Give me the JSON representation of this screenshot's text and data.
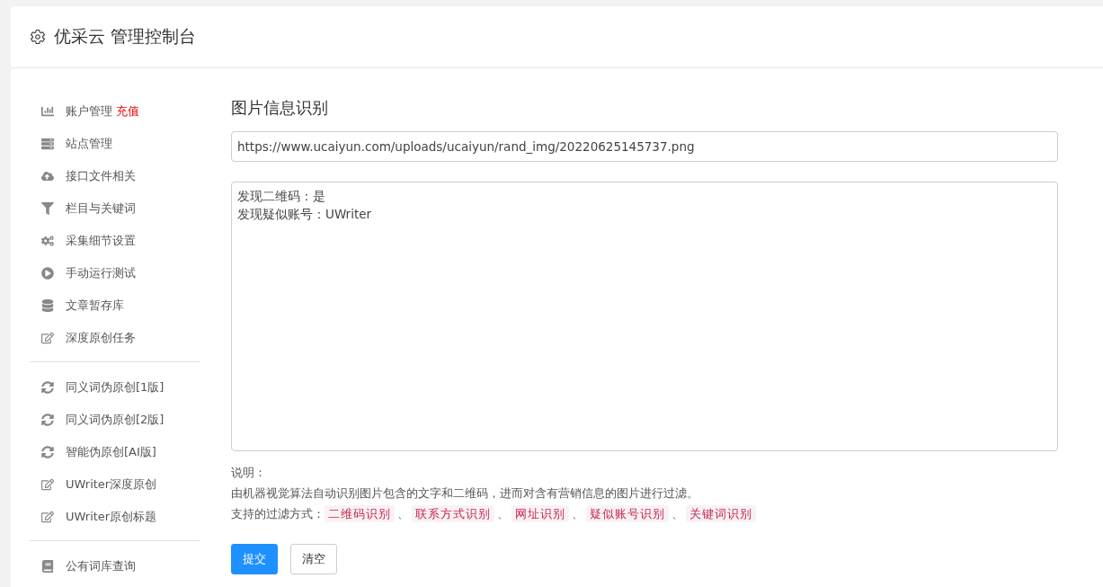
{
  "header": {
    "title": "优采云 管理控制台"
  },
  "sidebar": {
    "groups": [
      {
        "items": [
          {
            "label": "账户管理",
            "badge": "充值"
          },
          {
            "label": "站点管理"
          },
          {
            "label": "接口文件相关"
          },
          {
            "label": "栏目与关键词"
          },
          {
            "label": "采集细节设置"
          },
          {
            "label": "手动运行测试"
          },
          {
            "label": "文章暂存库"
          },
          {
            "label": "深度原创任务"
          }
        ]
      },
      {
        "items": [
          {
            "label": "同义词伪原创[1版]"
          },
          {
            "label": "同义词伪原创[2版]"
          },
          {
            "label": "智能伪原创[AI版]"
          },
          {
            "label": "UWriter深度原创"
          },
          {
            "label": "UWriter原创标题"
          }
        ]
      },
      {
        "items": [
          {
            "label": "公有词库查询"
          }
        ]
      }
    ]
  },
  "main": {
    "title": "图片信息识别",
    "url_field": {
      "value": "https://www.ucaiyun.com/uploads/ucaiyun/rand_img/20220625145737.png"
    },
    "result_field": {
      "lines": [
        "发现二维码：是",
        "发现疑似账号：UWriter"
      ]
    },
    "note": {
      "heading": "说明：",
      "description": "由机器视觉算法自动识别图片包含的文字和二维码，进而对含有营销信息的图片进行过滤。",
      "methods_label": "支持的过滤方式：",
      "separator": "、",
      "methods": [
        "二维码识别",
        "联系方式识别",
        "网址识别",
        "疑似账号识别",
        "关键词识别"
      ]
    },
    "buttons": [
      {
        "label": "提交",
        "kind": "primary"
      },
      {
        "label": "清空",
        "kind": "default"
      }
    ]
  }
}
